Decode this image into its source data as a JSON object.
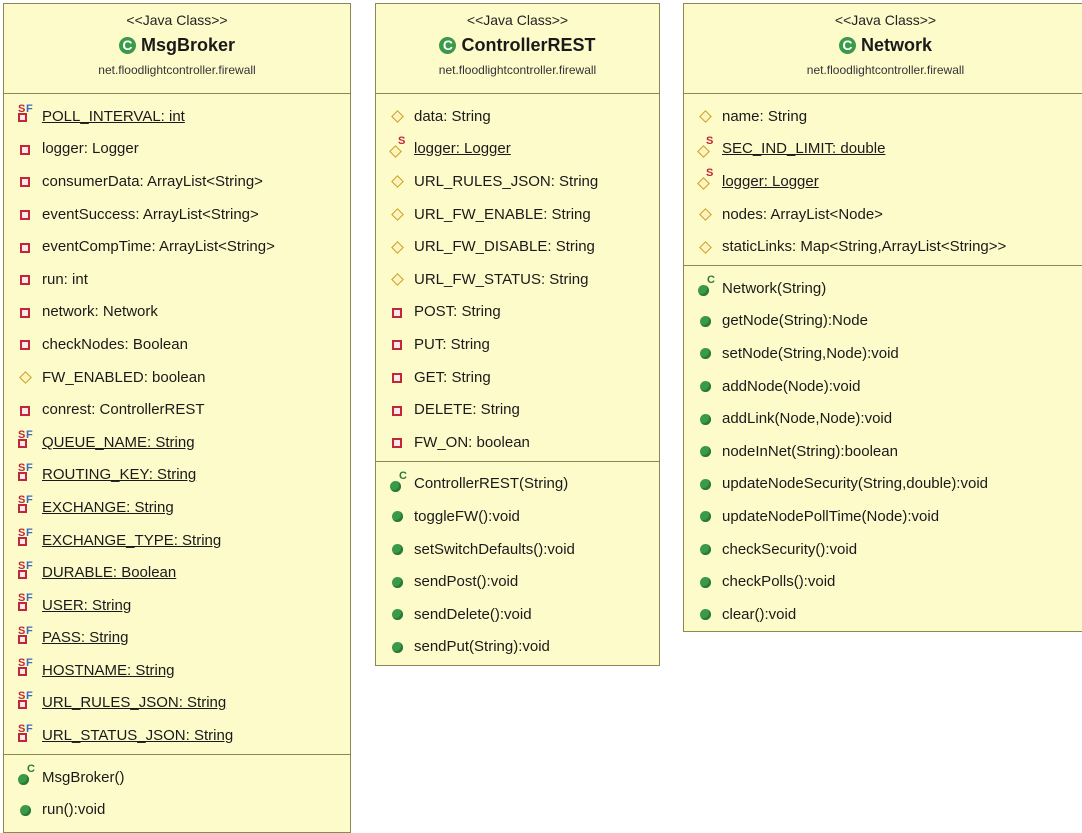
{
  "classes": [
    {
      "stereotype": "<<Java Class>>",
      "name": "MsgBroker",
      "package": "net.floodlightcontroller.firewall",
      "fields": [
        {
          "vis": "static-final-private",
          "text": "POLL_INTERVAL: int",
          "underline": true
        },
        {
          "vis": "private",
          "text": "logger: Logger",
          "underline": false
        },
        {
          "vis": "private",
          "text": "consumerData: ArrayList<String>",
          "underline": false
        },
        {
          "vis": "private",
          "text": "eventSuccess: ArrayList<String>",
          "underline": false
        },
        {
          "vis": "private",
          "text": "eventCompTime: ArrayList<String>",
          "underline": false
        },
        {
          "vis": "private",
          "text": "run: int",
          "underline": false
        },
        {
          "vis": "private",
          "text": "network: Network",
          "underline": false
        },
        {
          "vis": "private",
          "text": "checkNodes: Boolean",
          "underline": false
        },
        {
          "vis": "protected",
          "text": "FW_ENABLED: boolean",
          "underline": false
        },
        {
          "vis": "private",
          "text": "conrest: ControllerREST",
          "underline": false
        },
        {
          "vis": "static-final-private",
          "text": "QUEUE_NAME: String",
          "underline": true
        },
        {
          "vis": "static-final-private",
          "text": "ROUTING_KEY: String",
          "underline": true
        },
        {
          "vis": "static-final-private",
          "text": "EXCHANGE: String",
          "underline": true
        },
        {
          "vis": "static-final-private",
          "text": "EXCHANGE_TYPE: String",
          "underline": true
        },
        {
          "vis": "static-final-private",
          "text": "DURABLE: Boolean",
          "underline": true
        },
        {
          "vis": "static-final-private",
          "text": "USER: String",
          "underline": true
        },
        {
          "vis": "static-final-private",
          "text": "PASS: String",
          "underline": true
        },
        {
          "vis": "static-final-private",
          "text": "HOSTNAME: String",
          "underline": true
        },
        {
          "vis": "static-final-private",
          "text": "URL_RULES_JSON: String",
          "underline": true
        },
        {
          "vis": "static-final-private",
          "text": "URL_STATUS_JSON: String",
          "underline": true
        }
      ],
      "methods": [
        {
          "vis": "constructor",
          "text": "MsgBroker()"
        },
        {
          "vis": "public",
          "text": "run():void"
        }
      ]
    },
    {
      "stereotype": "<<Java Class>>",
      "name": "ControllerREST",
      "package": "net.floodlightcontroller.firewall",
      "fields": [
        {
          "vis": "protected",
          "text": "data: String",
          "underline": false
        },
        {
          "vis": "static-protected",
          "text": "logger: Logger",
          "underline": true
        },
        {
          "vis": "protected",
          "text": "URL_RULES_JSON: String",
          "underline": false
        },
        {
          "vis": "protected",
          "text": "URL_FW_ENABLE: String",
          "underline": false
        },
        {
          "vis": "protected",
          "text": "URL_FW_DISABLE: String",
          "underline": false
        },
        {
          "vis": "protected",
          "text": "URL_FW_STATUS: String",
          "underline": false
        },
        {
          "vis": "private",
          "text": "POST: String",
          "underline": false
        },
        {
          "vis": "private",
          "text": "PUT: String",
          "underline": false
        },
        {
          "vis": "private",
          "text": "GET: String",
          "underline": false
        },
        {
          "vis": "private",
          "text": "DELETE: String",
          "underline": false
        },
        {
          "vis": "private",
          "text": "FW_ON: boolean",
          "underline": false
        }
      ],
      "methods": [
        {
          "vis": "constructor",
          "text": "ControllerREST(String)"
        },
        {
          "vis": "public",
          "text": "toggleFW():void"
        },
        {
          "vis": "public",
          "text": "setSwitchDefaults():void"
        },
        {
          "vis": "public",
          "text": "sendPost():void"
        },
        {
          "vis": "public",
          "text": "sendDelete():void"
        },
        {
          "vis": "public",
          "text": "sendPut(String):void"
        }
      ]
    },
    {
      "stereotype": "<<Java Class>>",
      "name": "Network",
      "package": "net.floodlightcontroller.firewall",
      "fields": [
        {
          "vis": "protected",
          "text": "name: String",
          "underline": false
        },
        {
          "vis": "static-protected",
          "text": "SEC_IND_LIMIT: double",
          "underline": true
        },
        {
          "vis": "static-protected",
          "text": "logger: Logger",
          "underline": true
        },
        {
          "vis": "protected",
          "text": "nodes: ArrayList<Node>",
          "underline": false
        },
        {
          "vis": "protected",
          "text": "staticLinks: Map<String,ArrayList<String>>",
          "underline": false
        }
      ],
      "methods": [
        {
          "vis": "constructor",
          "text": "Network(String)"
        },
        {
          "vis": "public",
          "text": "getNode(String):Node"
        },
        {
          "vis": "public",
          "text": "setNode(String,Node):void"
        },
        {
          "vis": "public",
          "text": "addNode(Node):void"
        },
        {
          "vis": "public",
          "text": "addLink(Node,Node):void"
        },
        {
          "vis": "public",
          "text": "nodeInNet(String):boolean"
        },
        {
          "vis": "public",
          "text": "updateNodeSecurity(String,double):void"
        },
        {
          "vis": "public",
          "text": "updateNodePollTime(Node):void"
        },
        {
          "vis": "public",
          "text": "checkSecurity():void"
        },
        {
          "vis": "public",
          "text": "checkPolls():void"
        },
        {
          "vis": "public",
          "text": "clear():void"
        }
      ]
    }
  ]
}
